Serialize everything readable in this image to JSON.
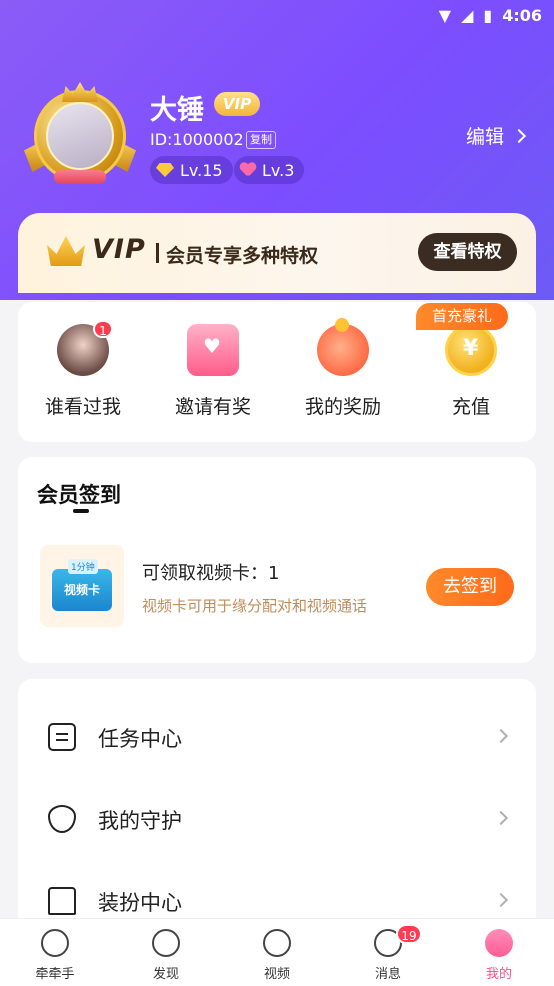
{
  "status": {
    "time": "4:06"
  },
  "profile": {
    "name": "大锤",
    "vip_badge": "VIP",
    "id_text": "ID:1000002",
    "copy_label": "复制",
    "level_gem": "Lv.15",
    "level_heart": "Lv.3",
    "edit_label": "编辑"
  },
  "vip_banner": {
    "logo": "VIP",
    "slogan": "会员专享多种特权",
    "button": "查看特权"
  },
  "quick_actions": [
    {
      "label": "谁看过我",
      "badge": "1"
    },
    {
      "label": "邀请有奖"
    },
    {
      "label": "我的奖励"
    },
    {
      "label": "充值",
      "tag": "首充豪礼"
    }
  ],
  "checkin": {
    "title": "会员签到",
    "card_tag": "1分钟",
    "card_label": "视频卡",
    "main_text": "可领取视频卡：1",
    "sub_text": "视频卡可用于缘分配对和视频通话",
    "button": "去签到"
  },
  "menu": [
    {
      "label": "任务中心"
    },
    {
      "label": "我的守护"
    },
    {
      "label": "装扮中心"
    }
  ],
  "tabbar": [
    {
      "label": "牵牵手"
    },
    {
      "label": "发现"
    },
    {
      "label": "视频"
    },
    {
      "label": "消息",
      "badge": "19"
    },
    {
      "label": "我的"
    }
  ],
  "colors": {
    "accent_purple": "#7c4dff",
    "accent_orange": "#ff7a24",
    "active_pink": "#ff4f8a"
  }
}
